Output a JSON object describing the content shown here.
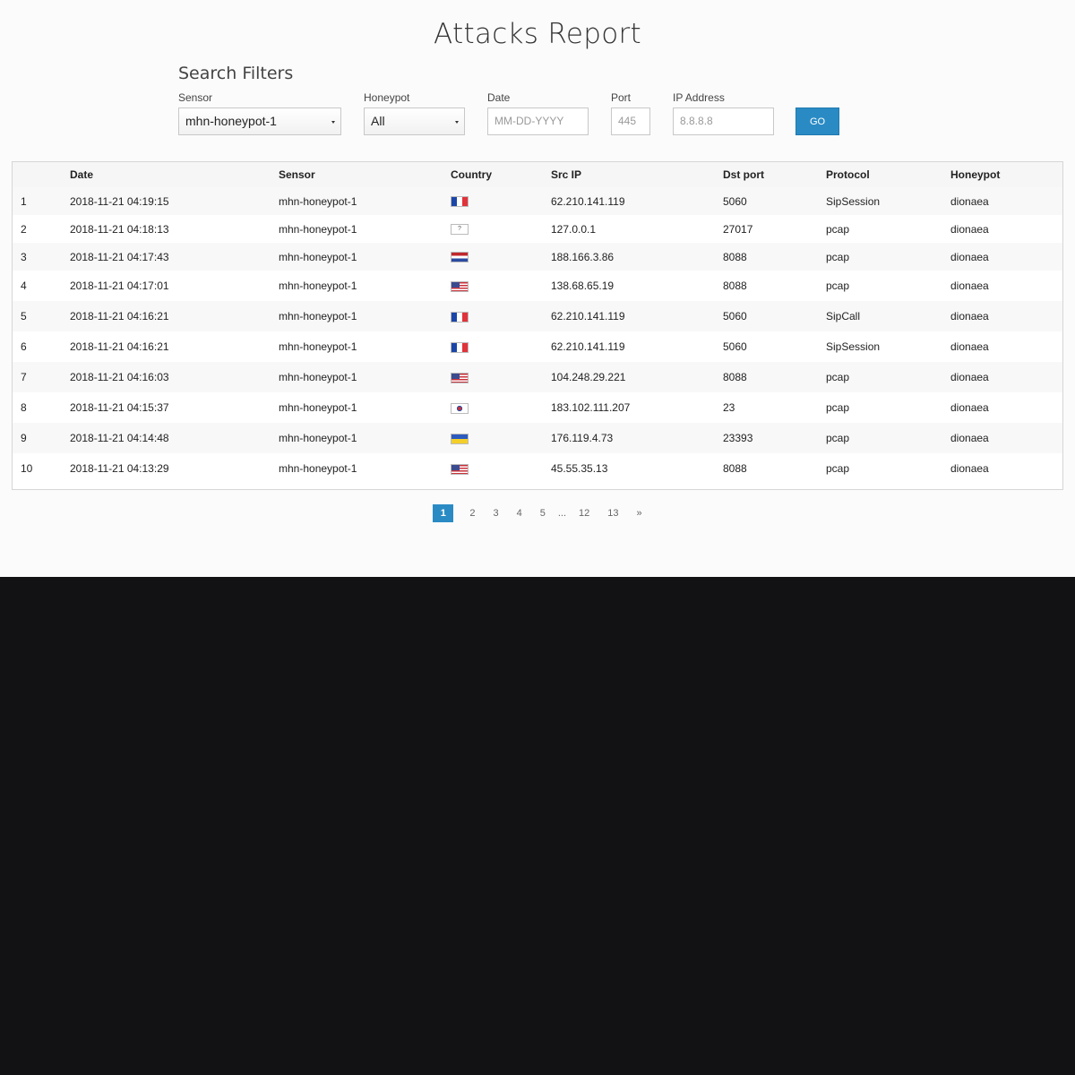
{
  "page_title": "Attacks Report",
  "filters": {
    "heading": "Search Filters",
    "sensor_label": "Sensor",
    "sensor_value": "mhn-honeypot-1",
    "honeypot_label": "Honeypot",
    "honeypot_value": "All",
    "date_label": "Date",
    "date_placeholder": "MM-DD-YYYY",
    "port_label": "Port",
    "port_placeholder": "445",
    "ip_label": "IP Address",
    "ip_placeholder": "8.8.8.8",
    "go_label": "GO"
  },
  "table": {
    "columns": [
      "",
      "Date",
      "Sensor",
      "Country",
      "Src IP",
      "Dst port",
      "Protocol",
      "Honeypot"
    ],
    "rows": [
      {
        "n": "1",
        "date": "2018-11-21 04:19:15",
        "sensor": "mhn-honeypot-1",
        "flag": "fr",
        "src_ip": "62.210.141.119",
        "dst_port": "5060",
        "protocol": "SipSession",
        "honeypot": "dionaea"
      },
      {
        "n": "2",
        "date": "2018-11-21 04:18:13",
        "sensor": "mhn-honeypot-1",
        "flag": "unknown",
        "src_ip": "127.0.0.1",
        "dst_port": "27017",
        "protocol": "pcap",
        "honeypot": "dionaea"
      },
      {
        "n": "3",
        "date": "2018-11-21 04:17:43",
        "sensor": "mhn-honeypot-1",
        "flag": "nl",
        "src_ip": "188.166.3.86",
        "dst_port": "8088",
        "protocol": "pcap",
        "honeypot": "dionaea"
      },
      {
        "n": "4",
        "date": "2018-11-21 04:17:01",
        "sensor": "mhn-honeypot-1",
        "flag": "us",
        "src_ip": "138.68.65.19",
        "dst_port": "8088",
        "protocol": "pcap",
        "honeypot": "dionaea"
      },
      {
        "n": "5",
        "date": "2018-11-21 04:16:21",
        "sensor": "mhn-honeypot-1",
        "flag": "fr",
        "src_ip": "62.210.141.119",
        "dst_port": "5060",
        "protocol": "SipCall",
        "honeypot": "dionaea"
      },
      {
        "n": "6",
        "date": "2018-11-21 04:16:21",
        "sensor": "mhn-honeypot-1",
        "flag": "fr",
        "src_ip": "62.210.141.119",
        "dst_port": "5060",
        "protocol": "SipSession",
        "honeypot": "dionaea"
      },
      {
        "n": "7",
        "date": "2018-11-21 04:16:03",
        "sensor": "mhn-honeypot-1",
        "flag": "us",
        "src_ip": "104.248.29.221",
        "dst_port": "8088",
        "protocol": "pcap",
        "honeypot": "dionaea"
      },
      {
        "n": "8",
        "date": "2018-11-21 04:15:37",
        "sensor": "mhn-honeypot-1",
        "flag": "kr",
        "src_ip": "183.102.111.207",
        "dst_port": "23",
        "protocol": "pcap",
        "honeypot": "dionaea"
      },
      {
        "n": "9",
        "date": "2018-11-21 04:14:48",
        "sensor": "mhn-honeypot-1",
        "flag": "ua",
        "src_ip": "176.119.4.73",
        "dst_port": "23393",
        "protocol": "pcap",
        "honeypot": "dionaea"
      },
      {
        "n": "10",
        "date": "2018-11-21 04:13:29",
        "sensor": "mhn-honeypot-1",
        "flag": "us",
        "src_ip": "45.55.35.13",
        "dst_port": "8088",
        "protocol": "pcap",
        "honeypot": "dionaea"
      }
    ]
  },
  "pagination": {
    "active": "1",
    "pages": [
      "2",
      "3",
      "4",
      "5"
    ],
    "ellipsis": "...",
    "tail_pages": [
      "12",
      "13"
    ],
    "next": "»"
  },
  "colors": {
    "accent": "#2a8bc4",
    "page_bg": "#fbfbfb",
    "lower_bg": "#121214"
  }
}
